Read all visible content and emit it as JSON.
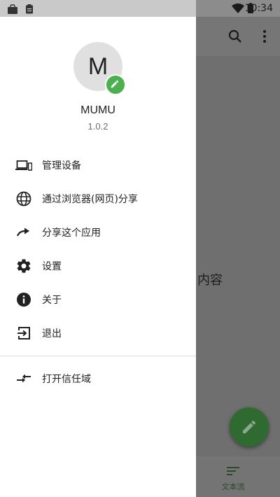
{
  "status_bar": {
    "time": "10:34",
    "icons": [
      "bag-icon",
      "clipboard-icon",
      "wifi-icon",
      "battery-icon"
    ]
  },
  "app": {
    "actions": [
      "search-icon",
      "more-vert-icon"
    ],
    "content_text": "内容",
    "fab_icon": "pencil-icon",
    "bottom_tab_label": "文本流",
    "bottom_tab_icon": "notes-icon"
  },
  "drawer": {
    "avatar_letter": "M",
    "user_name": "MUMU",
    "version": "1.0.2",
    "menu": [
      {
        "label": "管理设备",
        "icon": "devices-icon"
      },
      {
        "label": "通过浏览器(网页)分享",
        "icon": "globe-icon"
      },
      {
        "label": "分享这个应用",
        "icon": "share-arrow-icon"
      },
      {
        "label": "设置",
        "icon": "gear-icon"
      },
      {
        "label": "关于",
        "icon": "info-icon"
      },
      {
        "label": "退出",
        "icon": "exit-icon"
      }
    ],
    "secondary_menu": [
      {
        "label": "打开信任域",
        "icon": "compare-arrows-icon"
      }
    ]
  },
  "colors": {
    "accent": "#4caf50",
    "fab_dimmed": "#2f6b31",
    "scrim": "#6f6f6f",
    "drawer_bg": "#ffffff"
  }
}
